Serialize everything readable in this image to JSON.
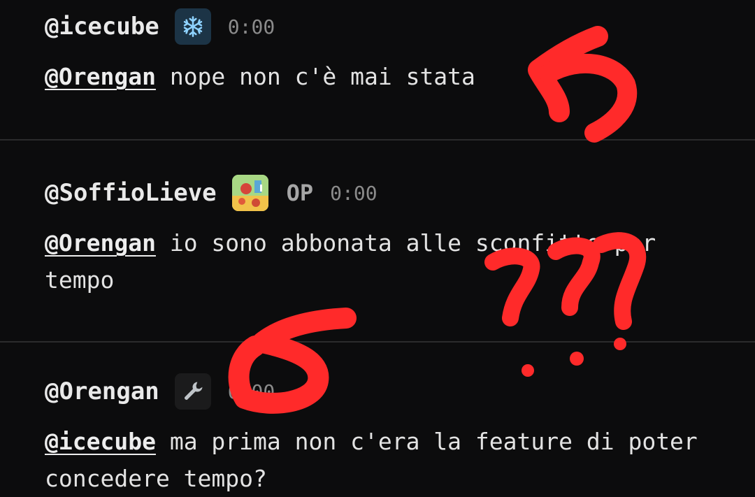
{
  "comments": [
    {
      "username": "@icecube",
      "badge_icon": "snowflake-icon",
      "time": "0:00",
      "mention": "@Orengan",
      "text": " nope non c'è mai stata"
    },
    {
      "username": "@SoffioLieve",
      "badge_icon": "avatar-picture",
      "op_label": "OP",
      "time": "0:00",
      "mention": "@Orengan",
      "text": " io sono abbonata alle sconfitte per tempo"
    },
    {
      "username": "@Orengan",
      "badge_icon": "wrench-icon",
      "time": "0:00",
      "mention": "@icecube",
      "text": " ma prima non c'era la feature di poter concedere tempo?"
    }
  ],
  "annotation_color": "#ff2a2a"
}
